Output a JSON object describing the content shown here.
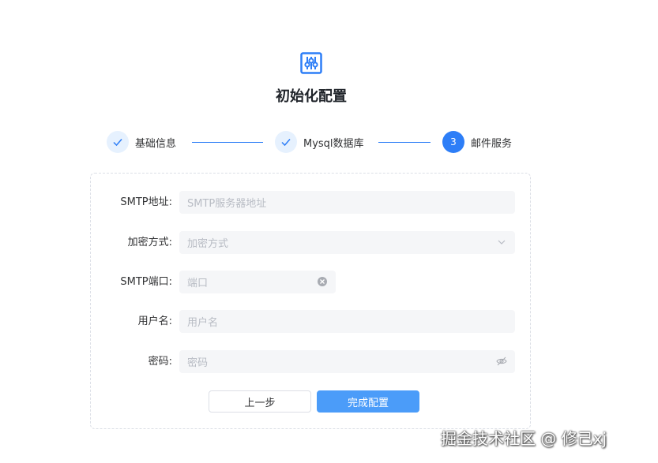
{
  "page_title": "初始化配置",
  "steps": [
    {
      "label": "基础信息",
      "state": "done"
    },
    {
      "label": "Mysql数据库",
      "state": "done"
    },
    {
      "label": "邮件服务",
      "state": "active",
      "number": "3"
    }
  ],
  "form": {
    "smtp_address": {
      "label": "SMTP地址:",
      "placeholder": "SMTP服务器地址",
      "value": ""
    },
    "encryption": {
      "label": "加密方式:",
      "placeholder": "加密方式",
      "value": ""
    },
    "smtp_port": {
      "label": "SMTP端口:",
      "placeholder": "端口",
      "value": ""
    },
    "username": {
      "label": "用户名:",
      "placeholder": "用户名",
      "value": ""
    },
    "password": {
      "label": "密码:",
      "placeholder": "密码",
      "value": ""
    }
  },
  "buttons": {
    "prev": "上一步",
    "finish": "完成配置"
  },
  "watermark": "掘金技术社区 @ 修己xj",
  "colors": {
    "accent": "#2d7ef7",
    "button_primary": "#4b9cf9",
    "field_bg": "#f5f6f8"
  }
}
